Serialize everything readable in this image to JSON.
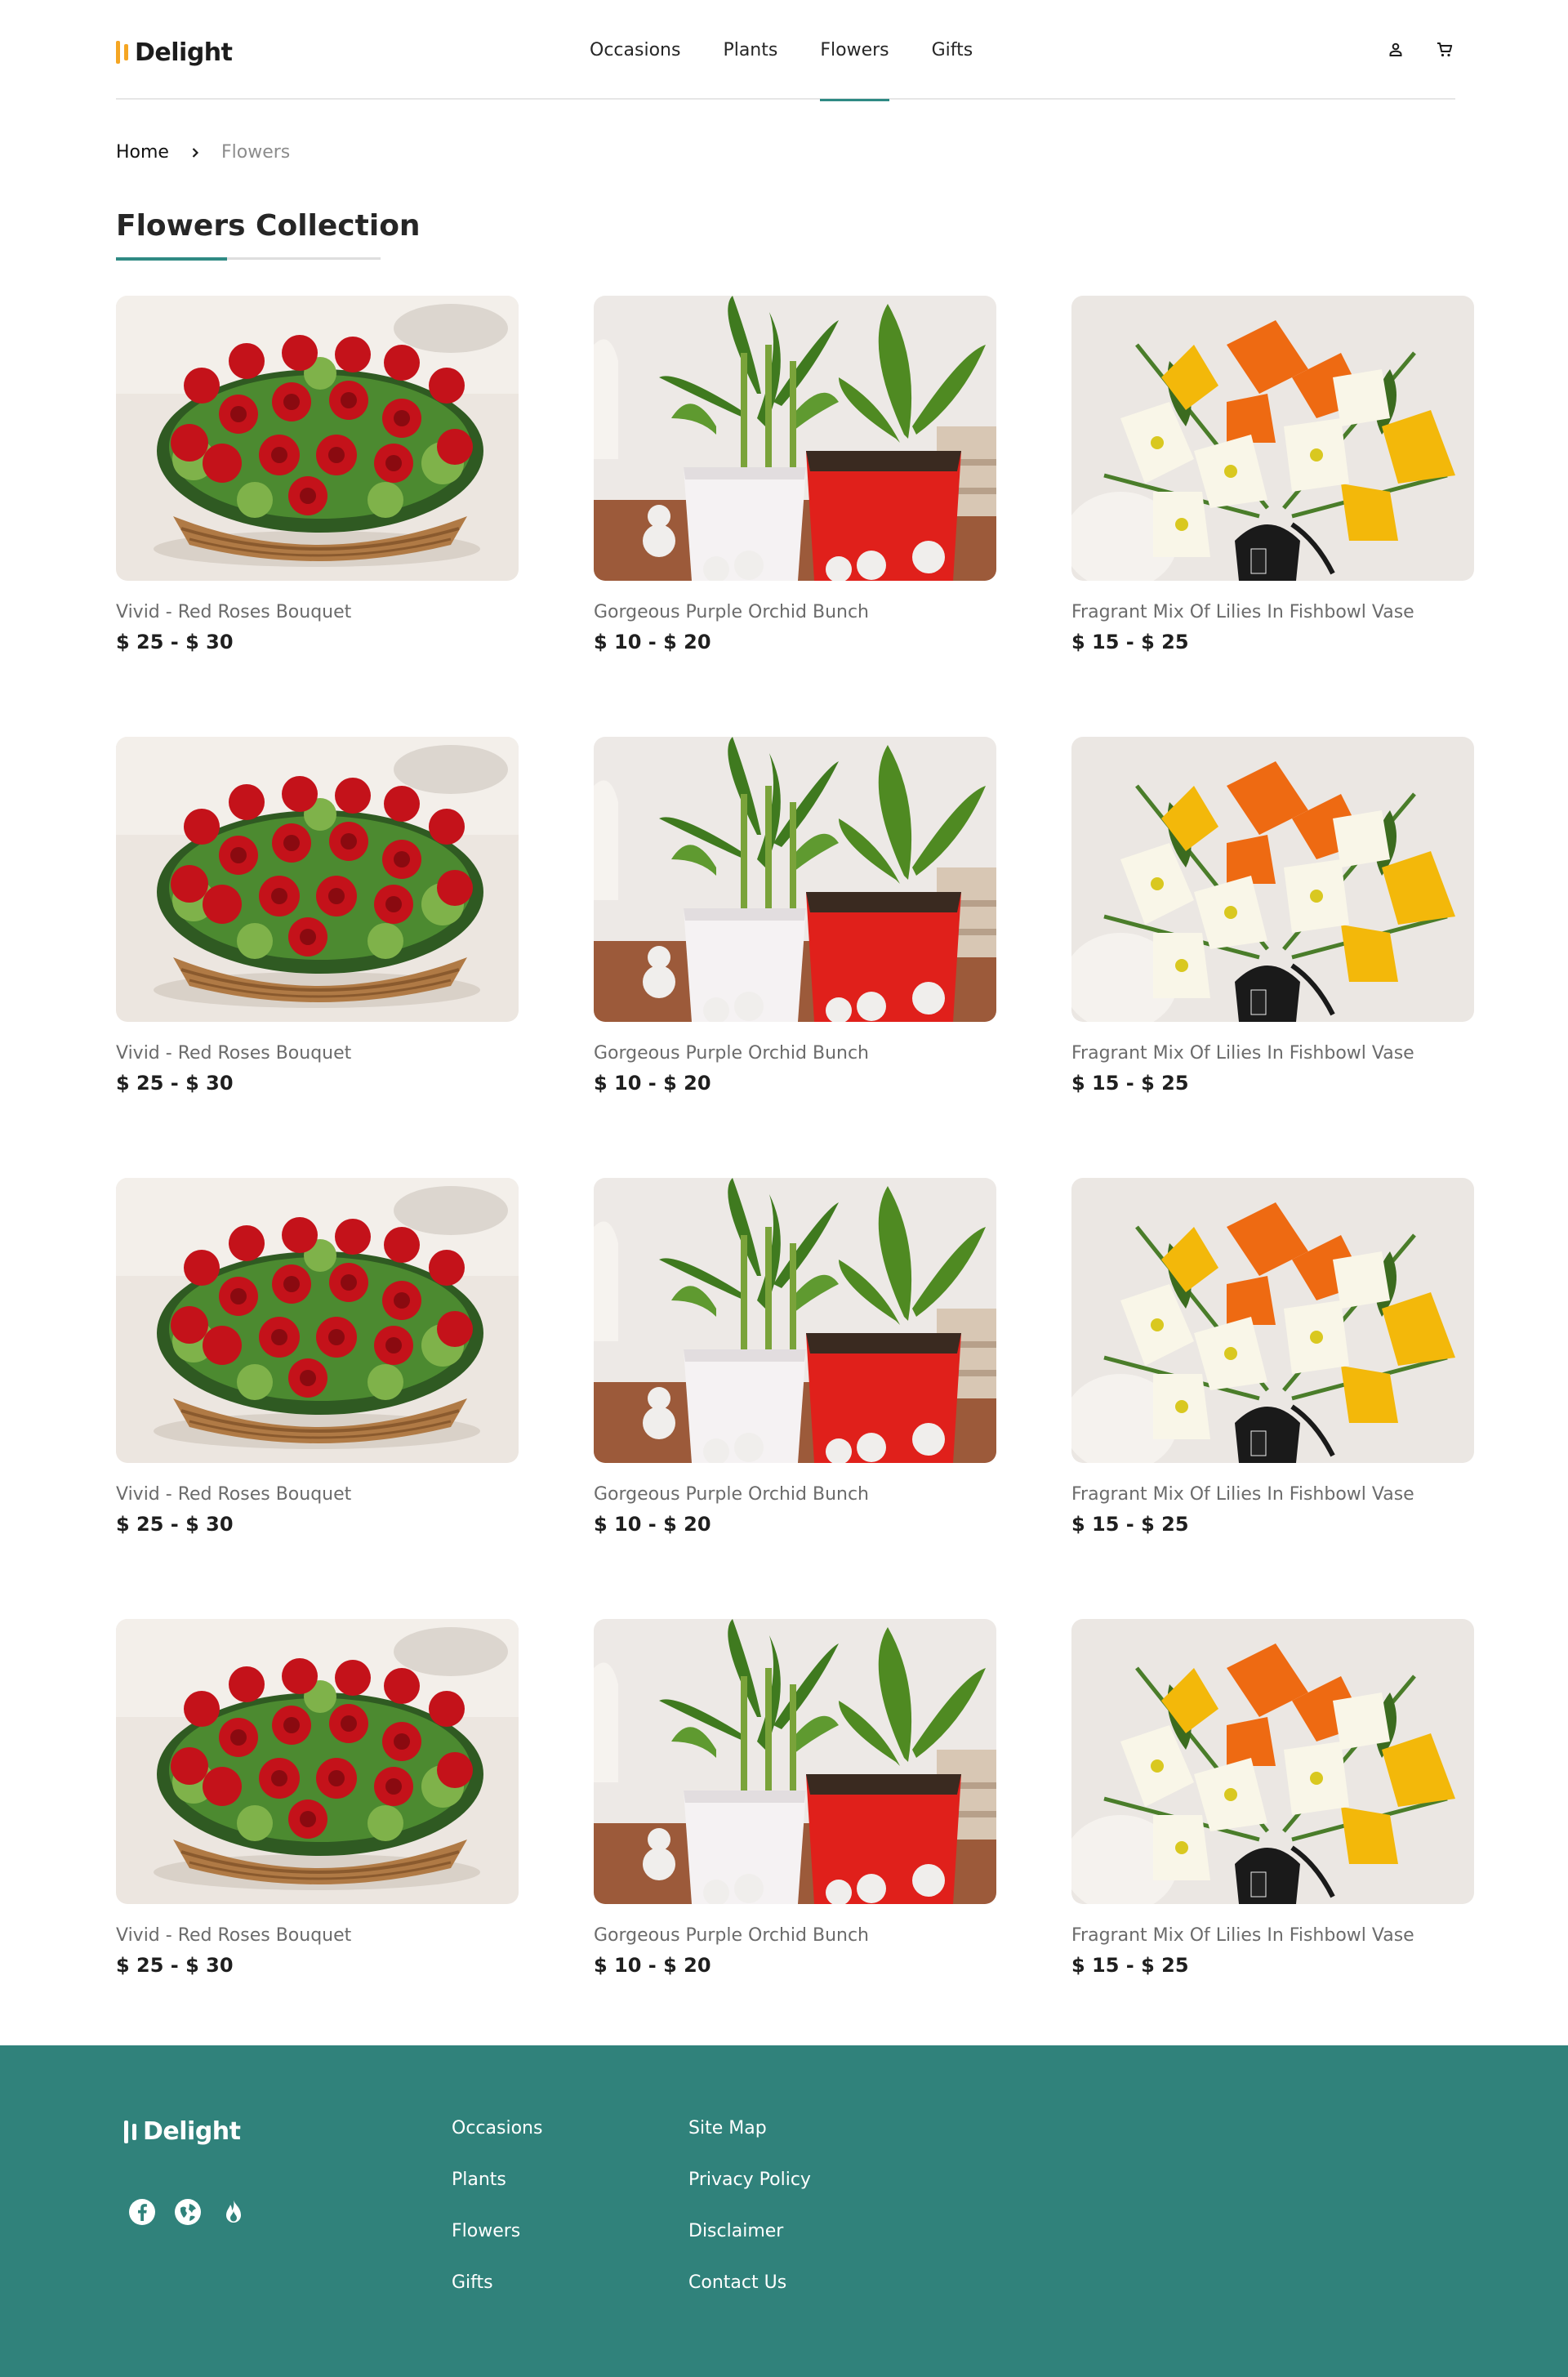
{
  "header": {
    "brand": "Delight",
    "nav": [
      "Occasions",
      "Plants",
      "Flowers",
      "Gifts"
    ],
    "active_nav": "Flowers",
    "icons": [
      "user-icon",
      "cart-icon"
    ]
  },
  "breadcrumb": {
    "home": "Home",
    "current": "Flowers"
  },
  "page_title": "Flowers Collection",
  "products": [
    {
      "name": "Vivid - Red Roses Bouquet",
      "price": "$ 25 - $ 30",
      "image": "red-roses-basket"
    },
    {
      "name": "Gorgeous Purple Orchid Bunch",
      "price": "$ 10 - $ 20",
      "image": "potted-plants"
    },
    {
      "name": "Fragrant Mix Of Lilies In Fishbowl Vase",
      "price": "$ 15 - $ 25",
      "image": "mixed-lilies"
    },
    {
      "name": "Vivid - Red Roses Bouquet",
      "price": "$ 25 - $ 30",
      "image": "red-roses-basket"
    },
    {
      "name": "Gorgeous Purple Orchid Bunch",
      "price": "$ 10 - $ 20",
      "image": "potted-plants"
    },
    {
      "name": "Fragrant Mix Of Lilies In Fishbowl Vase",
      "price": "$ 15 - $ 25",
      "image": "mixed-lilies"
    },
    {
      "name": "Vivid - Red Roses Bouquet",
      "price": "$ 25 - $ 30",
      "image": "red-roses-basket"
    },
    {
      "name": "Gorgeous Purple Orchid Bunch",
      "price": "$ 10 - $ 20",
      "image": "potted-plants"
    },
    {
      "name": "Fragrant Mix Of Lilies In Fishbowl Vase",
      "price": "$ 15 - $ 25",
      "image": "mixed-lilies"
    },
    {
      "name": "Vivid - Red Roses Bouquet",
      "price": "$ 25 - $ 30",
      "image": "red-roses-basket"
    },
    {
      "name": "Gorgeous Purple Orchid Bunch",
      "price": "$ 10 - $ 20",
      "image": "potted-plants"
    },
    {
      "name": "Fragrant Mix Of Lilies In Fishbowl Vase",
      "price": "$ 15 - $ 25",
      "image": "mixed-lilies"
    }
  ],
  "footer": {
    "brand": "Delight",
    "social_icons": [
      "facebook-icon",
      "globe-icon",
      "flame-icon"
    ],
    "col1": [
      "Occasions",
      "Plants",
      "Flowers",
      "Gifts"
    ],
    "col2": [
      "Site Map",
      "Privacy Policy",
      "Disclaimer",
      "Contact Us"
    ]
  },
  "colors": {
    "accent": "#2f8a84",
    "footer_bg": "#30827b",
    "logo_mark": "#f5a623"
  }
}
